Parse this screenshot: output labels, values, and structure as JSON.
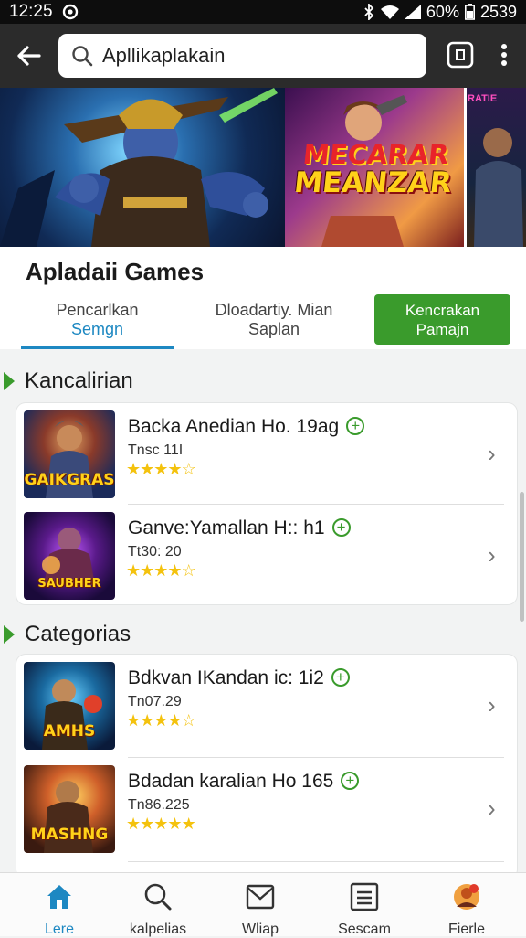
{
  "status": {
    "time": "12:25",
    "battery": "60%",
    "extra": "2539"
  },
  "search": {
    "query": "Apllikaplakain"
  },
  "banner": {
    "title_line1": "MECARAR",
    "title_line2": "MEANZAR",
    "mini_title": "RATIE"
  },
  "header": {
    "title": "Apladaii Games",
    "tabs": [
      {
        "line1": "Pencarlkan",
        "line2": "Semgn",
        "active": true
      },
      {
        "line1": "Dloadartiy. Mian",
        "line2": "Saplan",
        "active": false
      }
    ],
    "button": {
      "line1": "Kencrakan",
      "line2": "Pamajn"
    }
  },
  "sections": [
    {
      "title": "Kancalirian",
      "items": [
        {
          "name": "Backa Anedian Ho. 19ag",
          "meta": "Tnsc 11I",
          "thumb_label": "GAIKGRAS",
          "rating": 4
        },
        {
          "name": "Ganve:Yamallan H:: h1",
          "meta": "Tt30: 20",
          "thumb_label": "SAUBHER",
          "rating": 4
        }
      ]
    },
    {
      "title": "Categorias",
      "items": [
        {
          "name": "Bdkvan IKandan ic: 1i2",
          "meta": "Tn07.29",
          "thumb_label": "AMHS",
          "rating": 4
        },
        {
          "name": "Bdadan karalian Ho 165",
          "meta": "Tn86.225",
          "thumb_label": "MASHNG",
          "rating": 5
        }
      ]
    }
  ],
  "nav": [
    {
      "label": "Lere",
      "icon": "home-icon",
      "active": true
    },
    {
      "label": "kalpelias",
      "icon": "search-icon",
      "active": false
    },
    {
      "label": "Wliap",
      "icon": "mail-icon",
      "active": false
    },
    {
      "label": "Sescam",
      "icon": "list-icon",
      "active": false
    },
    {
      "label": "Fierle",
      "icon": "profile-icon",
      "active": false
    }
  ],
  "colors": {
    "accent": "#3a9b2c",
    "link": "#1d88c2",
    "appbar": "#2b2b2b",
    "star": "#f4c20d"
  }
}
